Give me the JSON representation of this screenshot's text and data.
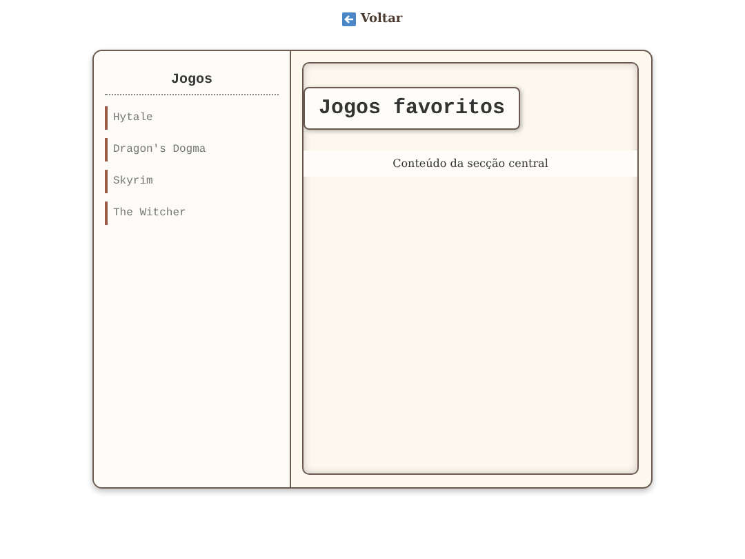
{
  "back_link": {
    "label": "Voltar"
  },
  "sidebar": {
    "title": "Jogos",
    "items": [
      {
        "label": "Hytale"
      },
      {
        "label": "Dragon's Dogma"
      },
      {
        "label": "Skyrim"
      },
      {
        "label": "The Witcher"
      }
    ]
  },
  "main": {
    "title": "Jogos favoritos",
    "content": "Conteúdo da secção central"
  }
}
